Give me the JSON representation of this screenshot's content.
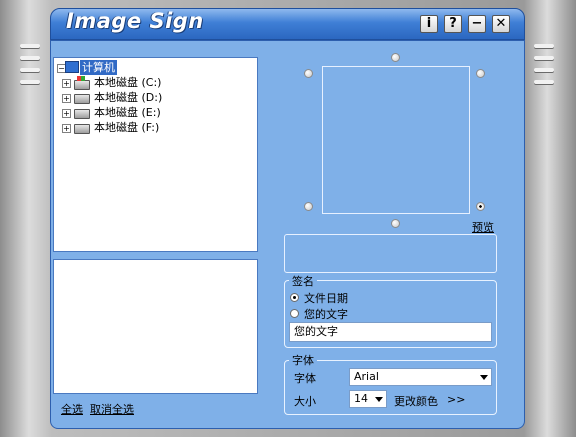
{
  "window": {
    "title": "Image Sign",
    "buttons": {
      "info": "i",
      "help": "?",
      "minimize": "−",
      "close": "✕"
    }
  },
  "tree": {
    "root": "计算机",
    "drives": [
      {
        "label": "本地磁盘 (C:)"
      },
      {
        "label": "本地磁盘 (D:)"
      },
      {
        "label": "本地磁盘 (E:)"
      },
      {
        "label": "本地磁盘 (F:)"
      }
    ]
  },
  "footer_links": {
    "select_all": "全选",
    "deselect_all": "取消全选"
  },
  "preview": {
    "label": "预览"
  },
  "signature": {
    "title": "签名",
    "option_date": "文件日期",
    "option_text": "您的文字",
    "text_value": "您的文字",
    "selected": "文件日期"
  },
  "font": {
    "title": "字体",
    "font_label": "字体",
    "font_value": "Arial",
    "size_label": "大小",
    "size_value": "14",
    "change_color": "更改颜色",
    "more": ">>"
  }
}
